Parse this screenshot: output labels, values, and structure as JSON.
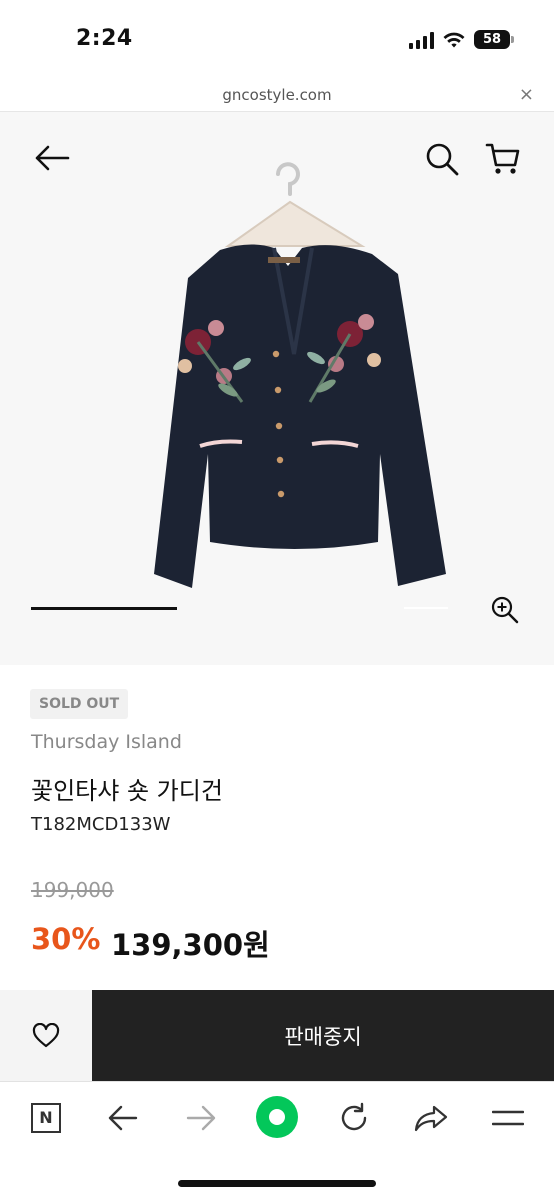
{
  "status_bar": {
    "time": "2:24",
    "battery": "58"
  },
  "browser": {
    "url": "gncostyle.com",
    "close_glyph": "×"
  },
  "header_icons": [
    "back-arrow-icon",
    "search-icon",
    "cart-icon"
  ],
  "product": {
    "badge": "SOLD OUT",
    "brand": "Thursday Island",
    "name": "꽃인타샤 숏 가디건",
    "code": "T182MCD133W",
    "original_price": "199,000",
    "discount": "30%",
    "sale_price": "139,300원"
  },
  "actions": {
    "wishlist_icon": "heart-icon",
    "primary_label": "판매중지"
  },
  "toolbar": {
    "n_label": "N",
    "items": [
      "naver-home-icon",
      "back-icon",
      "forward-icon",
      "green-dot-icon",
      "reload-icon",
      "share-icon",
      "menu-icon"
    ]
  },
  "colors": {
    "discount": "#e8561b",
    "dark_button": "#222222",
    "green": "#03c75a",
    "cardigan": "#1c2333"
  }
}
